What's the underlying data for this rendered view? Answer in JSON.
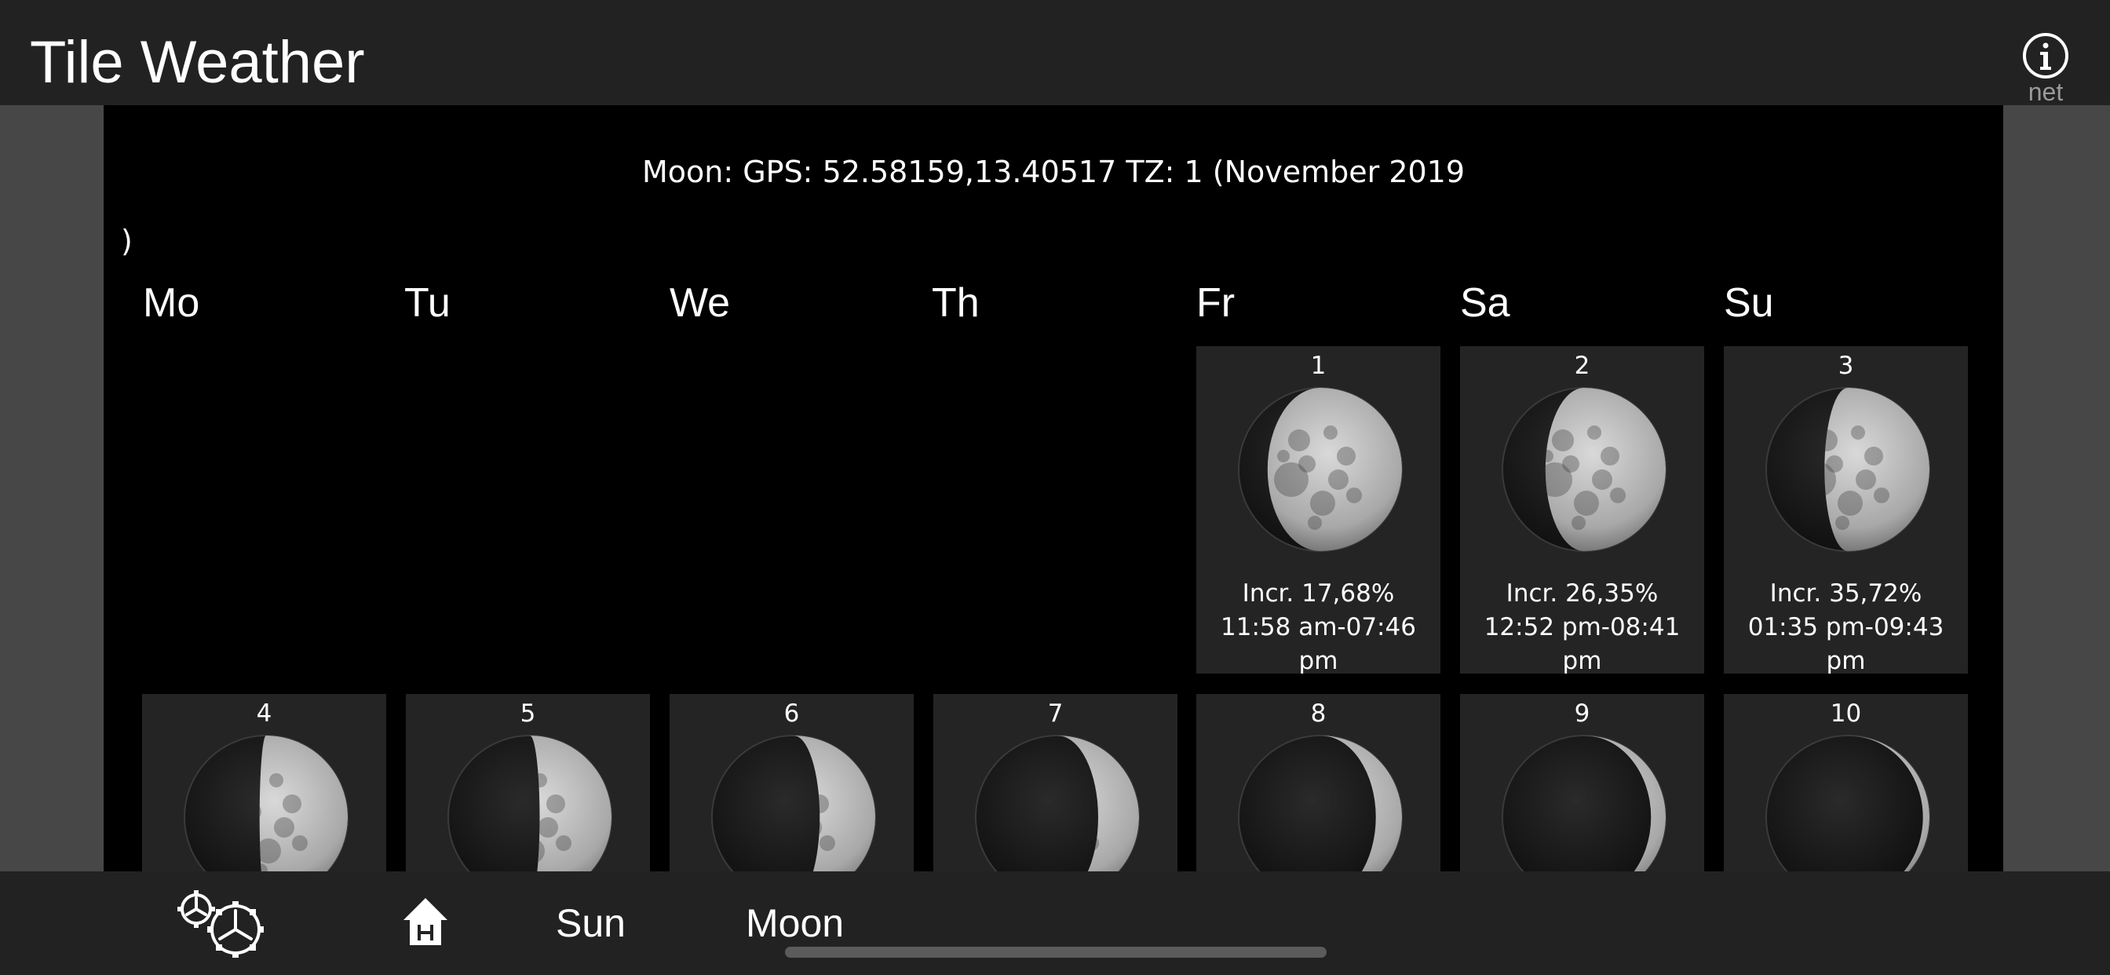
{
  "app": {
    "title": "Tile Weather"
  },
  "info": {
    "label": "net",
    "icon": "info-circle-icon"
  },
  "calendar": {
    "header": "Moon: GPS: 52.58159,13.40517 TZ: 1 (November 2019",
    "header_tail": ")",
    "weekdays": [
      "Mo",
      "Tu",
      "We",
      "Th",
      "Fr",
      "Sa",
      "Su"
    ],
    "days": [
      {
        "num": "1",
        "illumination": "Incr. 17,68%",
        "times_1": "11:58 am-07:46",
        "times_2": "pm",
        "lit_fraction": 0.1768
      },
      {
        "num": "2",
        "illumination": "Incr. 26,35%",
        "times_1": "12:52 pm-08:41",
        "times_2": "pm",
        "lit_fraction": 0.2635
      },
      {
        "num": "3",
        "illumination": "Incr. 35,72%",
        "times_1": "01:35 pm-09:43",
        "times_2": "pm",
        "lit_fraction": 0.3572
      },
      {
        "num": "4",
        "lit_fraction": 0.46
      },
      {
        "num": "5",
        "lit_fraction": 0.56
      },
      {
        "num": "6",
        "lit_fraction": 0.66
      },
      {
        "num": "7",
        "lit_fraction": 0.75
      },
      {
        "num": "8",
        "lit_fraction": 0.84
      },
      {
        "num": "9",
        "lit_fraction": 0.91
      },
      {
        "num": "10",
        "lit_fraction": 0.96
      }
    ]
  },
  "nav": {
    "settings_icon": "gears-icon",
    "home_icon": "home-icon",
    "sun_label": "Sun",
    "moon_label": "Moon"
  },
  "colors": {
    "bar_background": "#222222",
    "side_panel": "#474747",
    "content_background": "#000000",
    "cell_background": "#242424"
  }
}
